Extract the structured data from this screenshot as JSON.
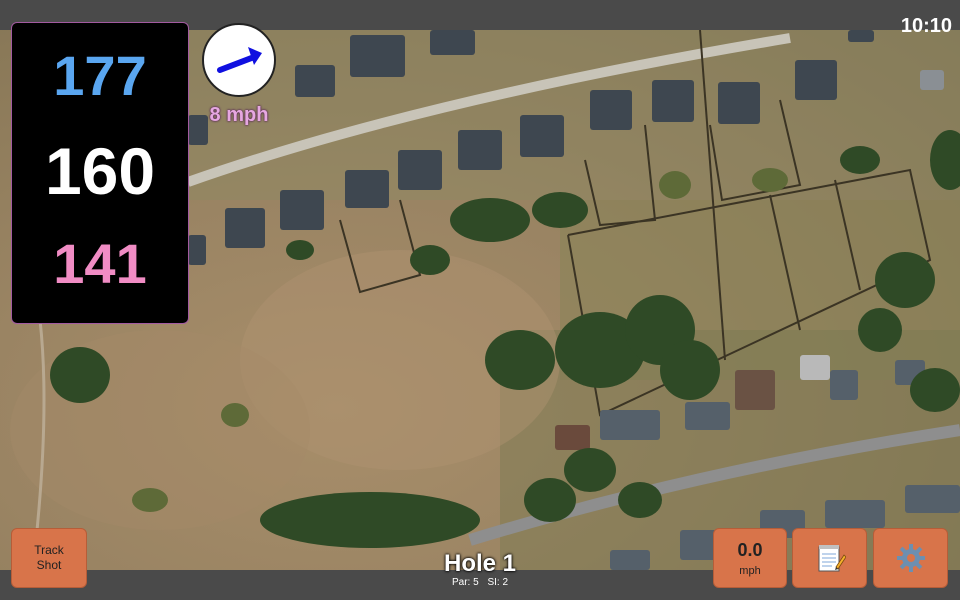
{
  "status": {
    "clock": "10:10"
  },
  "distances": {
    "back": "177",
    "center": "160",
    "front": "141"
  },
  "wind": {
    "speed_label": "8 mph",
    "icon": "wind-arrow-icon"
  },
  "buttons": {
    "track_shot_line1": "Track",
    "track_shot_line2": "Shot",
    "speed_value": "0.0",
    "speed_unit": "mph",
    "notes_icon": "notepad-icon",
    "settings_icon": "gear-icon"
  },
  "hole": {
    "title": "Hole 1",
    "par_label": "Par: 5",
    "si_label": "SI: 2"
  },
  "colors": {
    "back_distance": "#5aa6f0",
    "center_distance": "#ffffff",
    "front_distance": "#f08cc4",
    "button_bg": "#d8744a",
    "wind_text": "#e6a7e1"
  }
}
